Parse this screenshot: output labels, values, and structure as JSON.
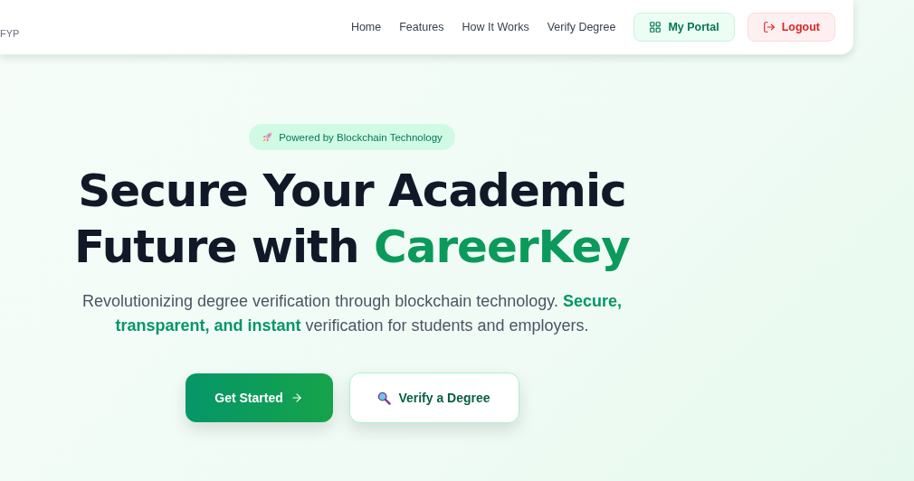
{
  "navbar": {
    "brand": "FYP",
    "links": [
      {
        "label": "Home"
      },
      {
        "label": "Features"
      },
      {
        "label": "How It Works"
      },
      {
        "label": "Verify Degree"
      }
    ],
    "actions": [
      {
        "label": "My Portal",
        "kind": "portal"
      },
      {
        "label": "Logout",
        "kind": "logout"
      }
    ]
  },
  "hero": {
    "badge": "Powered by Blockchain Technology",
    "title_start": "Secure Your Academic Future with",
    "title_highlight": "CareerKey",
    "subtitle": "Revolutionizing degree verification through blockchain technology. **Secure, transparent, and instant** verification for students and employers.",
    "buttons": [
      {
        "label": "Get Started",
        "kind": "primary"
      },
      {
        "label": "Verify a Degree",
        "kind": "secondary"
      }
    ]
  }
}
